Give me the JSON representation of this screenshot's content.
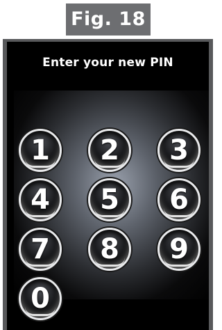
{
  "figure_label": "Fig. 18",
  "screen": {
    "prompt": "Enter your new PIN"
  },
  "keypad": {
    "keys": [
      "1",
      "2",
      "3",
      "4",
      "5",
      "6",
      "7",
      "8",
      "9",
      "0"
    ]
  }
}
